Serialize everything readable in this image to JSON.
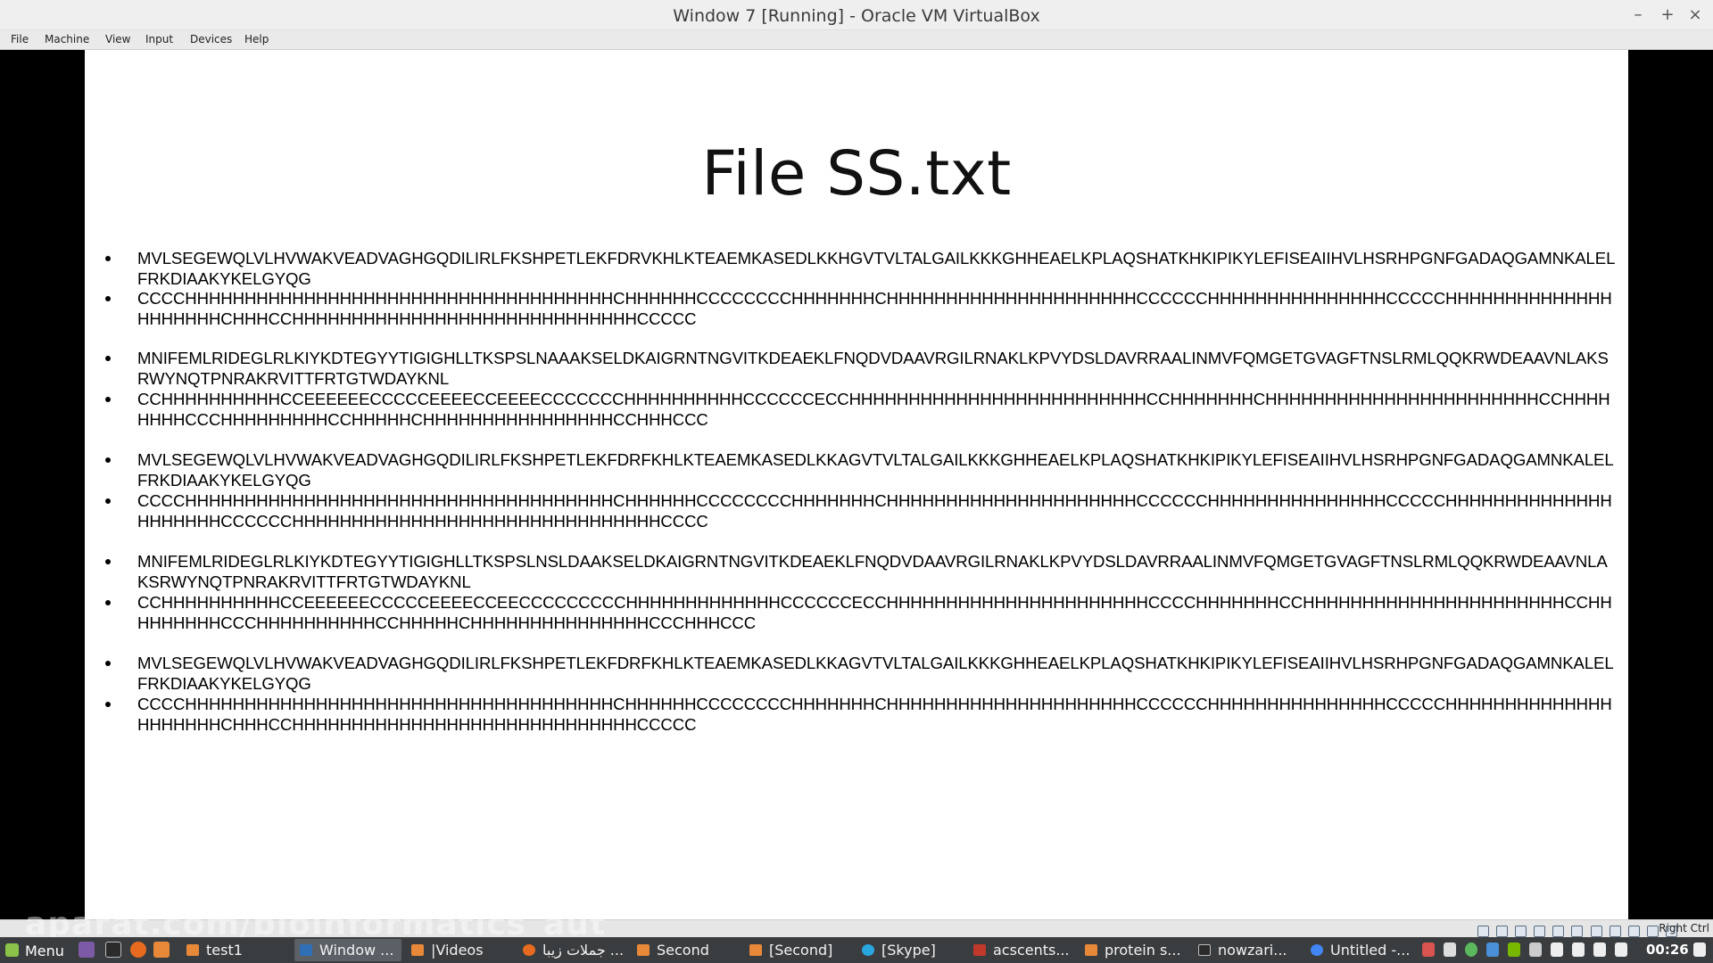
{
  "window": {
    "title": "Window 7  [Running] - Oracle VM VirtualBox",
    "controls": [
      "–",
      "+",
      "×"
    ]
  },
  "menubar": [
    "File",
    "Machine",
    "View",
    "Input",
    "Devices",
    "Help"
  ],
  "slide": {
    "title": "File SS.txt",
    "items": [
      "MVLSEGEWQLVLHVWAKVEADVAGHGQDILIRLFKSHPETLEKFDRVKHLKTEAEMKASEDLKKHGVTVLTALGAILKKKGHHEAELKPLAQSHATKHKIPIKYLEFISEAIIHVLHSRHPGNFGADAQGAMNKALELFRKDIAAKYKELGYQG",
      "CCCCHHHHHHHHHHHHHHHHHHHHHHHHHHHHHHHHHHHHCHHHHHHCCCCCCCCHHHHHHHCHHHHHHHHHHHHHHHHHHHHHCCCCCCHHHHHHHHHHHHHHHCCCCCHHHHHHHHHHHHHHHHHHHHHCHHHCCHHHHHHHHHHHHHHHHHHHHHHHHHHHHHCCCCC",
      "MNIFEMLRIDEGLRLKIYKDTEGYYTIGIGHLLTKSPSLNAAAKSELDKAIGRNTNGVITKDEAEKLFNQDVDAAVRGILRNAKLKPVYDSLDAVRRAALINMVFQMGETGVAGFTNSLRMLQQKRWDEAAVNLAKSRWYNQTPNRAKRVITTFRTGTWDAYKNL",
      "CCHHHHHHHHHHCCEEEEEECCCCCEEEECCEEEECCCCCCCHHHHHHHHHHCCCCCCECCHHHHHHHHHHHHHHHHHHHHHHHHHCCHHHHHHHCHHHHHHHHHHHHHHHHHHHHHHHCCHHHHHHHHCCCHHHHHHHHHCCHHHHHCHHHHHHHHHHHHHHHHCCHHHCCC",
      "MVLSEGEWQLVLHVWAKVEADVAGHGQDILIRLFKSHPETLEKFDRFKHLKTEAEMKASEDLKKAGVTVLTALGAILKKKGHHEAELKPLAQSHATKHKIPIKYLEFISEAIIHVLHSRHPGNFGADAQGAMNKALELFRKDIAAKYKELGYQG",
      "CCCCHHHHHHHHHHHHHHHHHHHHHHHHHHHHHHHHHHHHCHHHHHHCCCCCCCCHHHHHHHCHHHHHHHHHHHHHHHHHHHHHCCCCCCHHHHHHHHHHHHHHHCCCCCHHHHHHHHHHHHHHHHHHHHHCCCCCCHHHHHHHHHHHHHHHHHHHHHHHHHHHHHHHCCCC",
      "MNIFEMLRIDEGLRLKIYKDTEGYYTIGIGHLLTKSPSLNSLDAAKSELDKAIGRNTNGVITKDEAEKLFNQDVDAAVRGILRNAKLKPVYDSLDAVRRAALINMVFQMGETGVAGFTNSLRMLQQKRWDEAAVNLAKSRWYNQTPNRAKRVITTFRTGTWDAYKNL",
      "CCHHHHHHHHHHCCEEEEEECCCCCEEEECCEECCCCCCCCCHHHHHHHHHHHHHCCCCCCECCHHHHHHHHHHHHHHHHHHHHHHCCCCHHHHHHHCCHHHHHHHHHHHHHHHHHHHHHHCCHHHHHHHHHCCCHHHHHHHHHHCCHHHHHCHHHHHHHHHHHHHHHCCCHHHCCC",
      "MVLSEGEWQLVLHVWAKVEADVAGHGQDILIRLFKSHPETLEKFDRFKHLKTEAEMKASEDLKKAGVTVLTALGAILKKKGHHEAELKPLAQSHATKHKIPIKYLEFISEAIIHVLHSRHPGNFGADAQGAMNKALELFRKDIAAKYKELGYQG",
      "CCCCHHHHHHHHHHHHHHHHHHHHHHHHHHHHHHHHHHHHCHHHHHHCCCCCCCCHHHHHHHCHHHHHHHHHHHHHHHHHHHHHCCCCCCHHHHHHHHHHHHHHHCCCCCHHHHHHHHHHHHHHHHHHHHHCHHHCCHHHHHHHHHHHHHHHHHHHHHHHHHHHHHCCCCC"
    ]
  },
  "statusbar": {
    "watermark": "aparat.com/bioinformatics_aut",
    "host_key": "Right Ctrl"
  },
  "taskbar": {
    "menu_label": "Menu",
    "tasks": [
      {
        "label": "test1",
        "icon": "folder-icon",
        "active": false
      },
      {
        "label": "Window ...",
        "icon": "virtualbox-icon",
        "active": true
      },
      {
        "label": "|Videos",
        "icon": "folder-icon",
        "active": false
      },
      {
        "label": "جملات زیبا ...",
        "icon": "firefox-icon",
        "active": false
      },
      {
        "label": "Second",
        "icon": "folder-icon",
        "active": false
      },
      {
        "label": "[Second]",
        "icon": "folder-icon",
        "active": false
      },
      {
        "label": "[Skype]",
        "icon": "skype-icon",
        "active": false
      },
      {
        "label": "acscents...",
        "icon": "app-icon",
        "active": false
      },
      {
        "label": "protein s...",
        "icon": "folder-icon",
        "active": false
      },
      {
        "label": "nowzari...",
        "icon": "terminal-icon",
        "active": false
      },
      {
        "label": "Untitled -...",
        "icon": "chrome-icon",
        "active": false
      }
    ],
    "clock": "00:26"
  }
}
